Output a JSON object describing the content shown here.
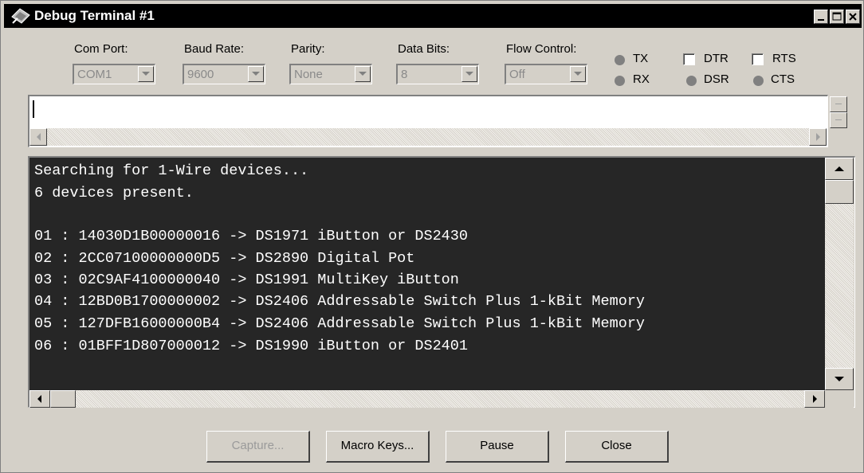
{
  "window": {
    "title": "Debug Terminal #1",
    "controls": [
      "minimize-icon",
      "maximize-icon",
      "close-icon"
    ]
  },
  "settings": {
    "com_port": {
      "label": "Com Port:",
      "value": "COM1"
    },
    "baud_rate": {
      "label": "Baud Rate:",
      "value": "9600"
    },
    "parity": {
      "label": "Parity:",
      "value": "None"
    },
    "data_bits": {
      "label": "Data Bits:",
      "value": "8"
    },
    "flow_control": {
      "label": "Flow Control:",
      "value": "Off"
    }
  },
  "indicators": {
    "tx": "TX",
    "rx": "RX",
    "dtr": "DTR",
    "rts": "RTS",
    "dsr": "DSR",
    "cts": "CTS",
    "led_color": "#808080"
  },
  "input": {
    "value": ""
  },
  "terminal": {
    "background": "#262626",
    "text_color": "#ffffff",
    "lines": [
      "Searching for 1-Wire devices...",
      "6 devices present.",
      "",
      "01 : 14030D1B00000016 -> DS1971 iButton or DS2430",
      "02 : 2CC07100000000D5 -> DS2890 Digital Pot",
      "03 : 02C9AF4100000040 -> DS1991 MultiKey iButton",
      "04 : 12BD0B1700000002 -> DS2406 Addressable Switch Plus 1-kBit Memory",
      "05 : 127DFB16000000B4 -> DS2406 Addressable Switch Plus 1-kBit Memory",
      "06 : 01BFF1D807000012 -> DS1990 iButton or DS2401"
    ]
  },
  "buttons": {
    "capture": "Capture...",
    "macro_keys": "Macro Keys...",
    "pause": "Pause",
    "close": "Close"
  }
}
